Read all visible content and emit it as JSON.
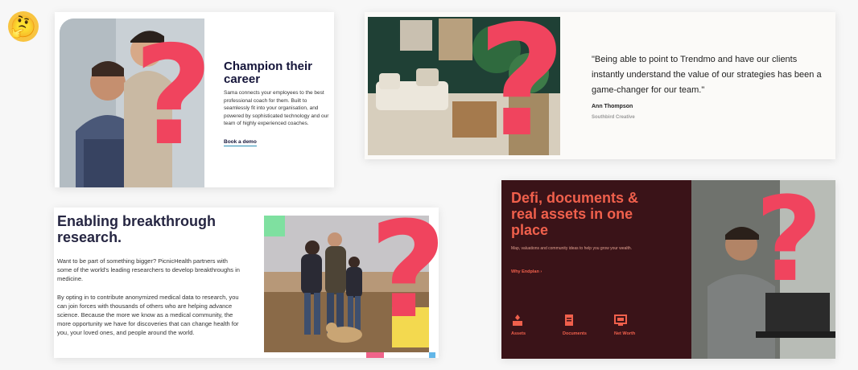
{
  "emoji": "🤔",
  "qmark": "?",
  "card1": {
    "title": "Champion their career",
    "description": "Sama connects your employees to the best professional coach for them. Built to seamlessly fit into your organisation, and powered by sophisticated technology and our team of highly experienced coaches.",
    "link": "Book a demo"
  },
  "card2": {
    "quote": "\"Being able to point to Trendmo and have our clients instantly understand the value of our strategies has been a game-changer for our team.\"",
    "author": "Ann Thompson",
    "company": "Southbird Creative"
  },
  "card3": {
    "heading": "Enabling breakthrough research.",
    "p1": "Want to be part of something bigger? PicnicHealth partners with some of the world's leading researchers to develop breakthroughs in medicine.",
    "p2": "By opting in to contribute anonymized medical data to research, you can join forces with thousands of others who are helping advance science. Because the more we know as a medical community, the more opportunity we have for discoveries that can change health for you, your loved ones, and people around the world."
  },
  "card4": {
    "heading": "Defi, documents & real assets in one place",
    "sub": "Map, valuations and community ideas to help you grow your wealth.",
    "link": "Why Endplan ›",
    "features": [
      {
        "label": "Assets",
        "icon": "assets-icon"
      },
      {
        "label": "Documents",
        "icon": "documents-icon"
      },
      {
        "label": "Net Worth",
        "icon": "net-worth-icon"
      }
    ]
  },
  "colors": {
    "qmark": "#f0445e",
    "navy": "#15153a",
    "burgundy": "#3a1318",
    "coral": "#f0604c"
  }
}
